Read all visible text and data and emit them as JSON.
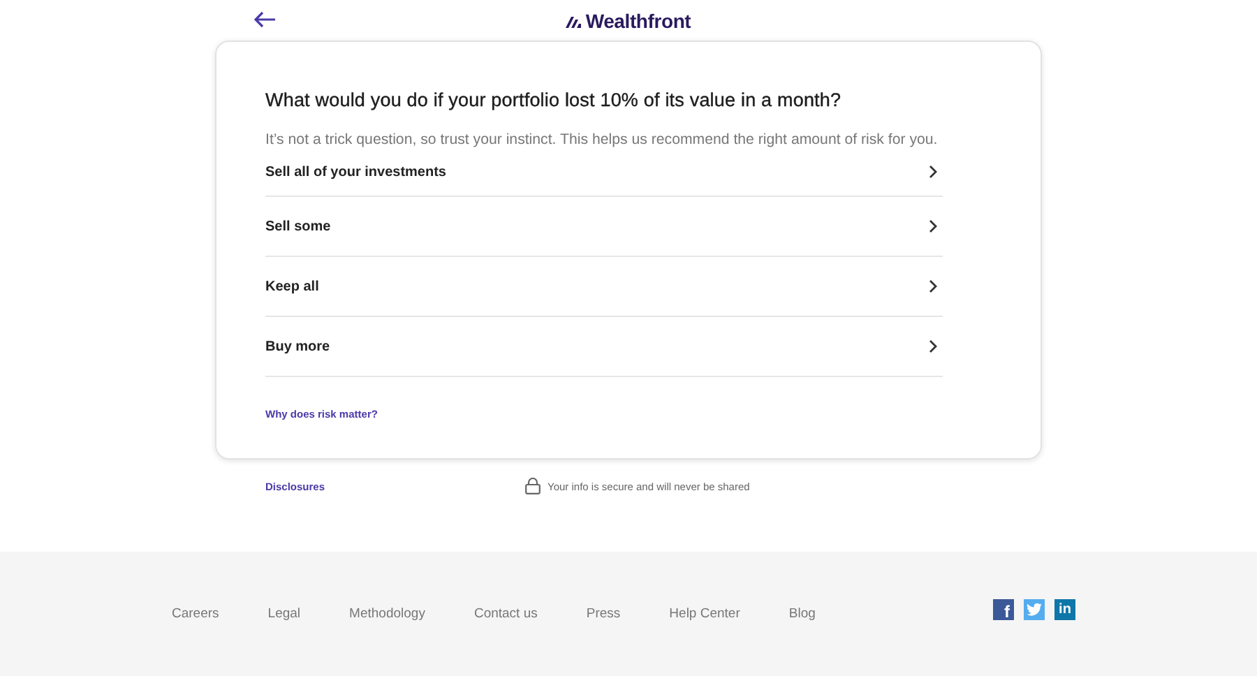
{
  "header": {
    "logo": "Wealthfront"
  },
  "question": {
    "title": "What would you do if your portfolio lost 10% of its value in a month?",
    "subtitle": "It’s not a trick question, so trust your instinct. This helps us recommend the right amount of risk for you.",
    "options": [
      {
        "label": "Sell all of your investments"
      },
      {
        "label": "Sell some"
      },
      {
        "label": "Keep all"
      },
      {
        "label": "Buy more"
      }
    ],
    "help_link": "Why does risk matter?"
  },
  "below_card": {
    "disclosures": "Disclosures",
    "security_note": "Your info is secure and will never be shared"
  },
  "footer": {
    "links": [
      "Careers",
      "Legal",
      "Methodology",
      "Contact us",
      "Press",
      "Help Center",
      "Blog"
    ],
    "social": [
      {
        "kind": "facebook",
        "text": "f",
        "color": "#3b5998"
      },
      {
        "kind": "twitter",
        "color": "#55acee"
      },
      {
        "kind": "linkedin",
        "text": "in",
        "color": "#0e76a8"
      }
    ]
  }
}
